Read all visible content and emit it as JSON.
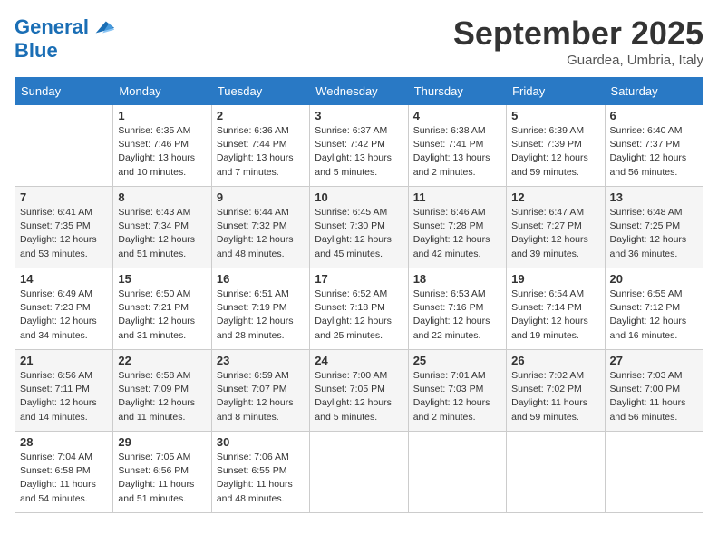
{
  "header": {
    "logo_line1": "General",
    "logo_line2": "Blue",
    "month": "September 2025",
    "location": "Guardea, Umbria, Italy"
  },
  "days_of_week": [
    "Sunday",
    "Monday",
    "Tuesday",
    "Wednesday",
    "Thursday",
    "Friday",
    "Saturday"
  ],
  "weeks": [
    [
      {
        "day": "",
        "empty": true
      },
      {
        "day": "1",
        "sunrise": "Sunrise: 6:35 AM",
        "sunset": "Sunset: 7:46 PM",
        "daylight": "Daylight: 13 hours and 10 minutes."
      },
      {
        "day": "2",
        "sunrise": "Sunrise: 6:36 AM",
        "sunset": "Sunset: 7:44 PM",
        "daylight": "Daylight: 13 hours and 7 minutes."
      },
      {
        "day": "3",
        "sunrise": "Sunrise: 6:37 AM",
        "sunset": "Sunset: 7:42 PM",
        "daylight": "Daylight: 13 hours and 5 minutes."
      },
      {
        "day": "4",
        "sunrise": "Sunrise: 6:38 AM",
        "sunset": "Sunset: 7:41 PM",
        "daylight": "Daylight: 13 hours and 2 minutes."
      },
      {
        "day": "5",
        "sunrise": "Sunrise: 6:39 AM",
        "sunset": "Sunset: 7:39 PM",
        "daylight": "Daylight: 12 hours and 59 minutes."
      },
      {
        "day": "6",
        "sunrise": "Sunrise: 6:40 AM",
        "sunset": "Sunset: 7:37 PM",
        "daylight": "Daylight: 12 hours and 56 minutes."
      }
    ],
    [
      {
        "day": "7",
        "sunrise": "Sunrise: 6:41 AM",
        "sunset": "Sunset: 7:35 PM",
        "daylight": "Daylight: 12 hours and 53 minutes."
      },
      {
        "day": "8",
        "sunrise": "Sunrise: 6:43 AM",
        "sunset": "Sunset: 7:34 PM",
        "daylight": "Daylight: 12 hours and 51 minutes."
      },
      {
        "day": "9",
        "sunrise": "Sunrise: 6:44 AM",
        "sunset": "Sunset: 7:32 PM",
        "daylight": "Daylight: 12 hours and 48 minutes."
      },
      {
        "day": "10",
        "sunrise": "Sunrise: 6:45 AM",
        "sunset": "Sunset: 7:30 PM",
        "daylight": "Daylight: 12 hours and 45 minutes."
      },
      {
        "day": "11",
        "sunrise": "Sunrise: 6:46 AM",
        "sunset": "Sunset: 7:28 PM",
        "daylight": "Daylight: 12 hours and 42 minutes."
      },
      {
        "day": "12",
        "sunrise": "Sunrise: 6:47 AM",
        "sunset": "Sunset: 7:27 PM",
        "daylight": "Daylight: 12 hours and 39 minutes."
      },
      {
        "day": "13",
        "sunrise": "Sunrise: 6:48 AM",
        "sunset": "Sunset: 7:25 PM",
        "daylight": "Daylight: 12 hours and 36 minutes."
      }
    ],
    [
      {
        "day": "14",
        "sunrise": "Sunrise: 6:49 AM",
        "sunset": "Sunset: 7:23 PM",
        "daylight": "Daylight: 12 hours and 34 minutes."
      },
      {
        "day": "15",
        "sunrise": "Sunrise: 6:50 AM",
        "sunset": "Sunset: 7:21 PM",
        "daylight": "Daylight: 12 hours and 31 minutes."
      },
      {
        "day": "16",
        "sunrise": "Sunrise: 6:51 AM",
        "sunset": "Sunset: 7:19 PM",
        "daylight": "Daylight: 12 hours and 28 minutes."
      },
      {
        "day": "17",
        "sunrise": "Sunrise: 6:52 AM",
        "sunset": "Sunset: 7:18 PM",
        "daylight": "Daylight: 12 hours and 25 minutes."
      },
      {
        "day": "18",
        "sunrise": "Sunrise: 6:53 AM",
        "sunset": "Sunset: 7:16 PM",
        "daylight": "Daylight: 12 hours and 22 minutes."
      },
      {
        "day": "19",
        "sunrise": "Sunrise: 6:54 AM",
        "sunset": "Sunset: 7:14 PM",
        "daylight": "Daylight: 12 hours and 19 minutes."
      },
      {
        "day": "20",
        "sunrise": "Sunrise: 6:55 AM",
        "sunset": "Sunset: 7:12 PM",
        "daylight": "Daylight: 12 hours and 16 minutes."
      }
    ],
    [
      {
        "day": "21",
        "sunrise": "Sunrise: 6:56 AM",
        "sunset": "Sunset: 7:11 PM",
        "daylight": "Daylight: 12 hours and 14 minutes."
      },
      {
        "day": "22",
        "sunrise": "Sunrise: 6:58 AM",
        "sunset": "Sunset: 7:09 PM",
        "daylight": "Daylight: 12 hours and 11 minutes."
      },
      {
        "day": "23",
        "sunrise": "Sunrise: 6:59 AM",
        "sunset": "Sunset: 7:07 PM",
        "daylight": "Daylight: 12 hours and 8 minutes."
      },
      {
        "day": "24",
        "sunrise": "Sunrise: 7:00 AM",
        "sunset": "Sunset: 7:05 PM",
        "daylight": "Daylight: 12 hours and 5 minutes."
      },
      {
        "day": "25",
        "sunrise": "Sunrise: 7:01 AM",
        "sunset": "Sunset: 7:03 PM",
        "daylight": "Daylight: 12 hours and 2 minutes."
      },
      {
        "day": "26",
        "sunrise": "Sunrise: 7:02 AM",
        "sunset": "Sunset: 7:02 PM",
        "daylight": "Daylight: 11 hours and 59 minutes."
      },
      {
        "day": "27",
        "sunrise": "Sunrise: 7:03 AM",
        "sunset": "Sunset: 7:00 PM",
        "daylight": "Daylight: 11 hours and 56 minutes."
      }
    ],
    [
      {
        "day": "28",
        "sunrise": "Sunrise: 7:04 AM",
        "sunset": "Sunset: 6:58 PM",
        "daylight": "Daylight: 11 hours and 54 minutes."
      },
      {
        "day": "29",
        "sunrise": "Sunrise: 7:05 AM",
        "sunset": "Sunset: 6:56 PM",
        "daylight": "Daylight: 11 hours and 51 minutes."
      },
      {
        "day": "30",
        "sunrise": "Sunrise: 7:06 AM",
        "sunset": "Sunset: 6:55 PM",
        "daylight": "Daylight: 11 hours and 48 minutes."
      },
      {
        "day": "",
        "empty": true
      },
      {
        "day": "",
        "empty": true
      },
      {
        "day": "",
        "empty": true
      },
      {
        "day": "",
        "empty": true
      }
    ]
  ]
}
